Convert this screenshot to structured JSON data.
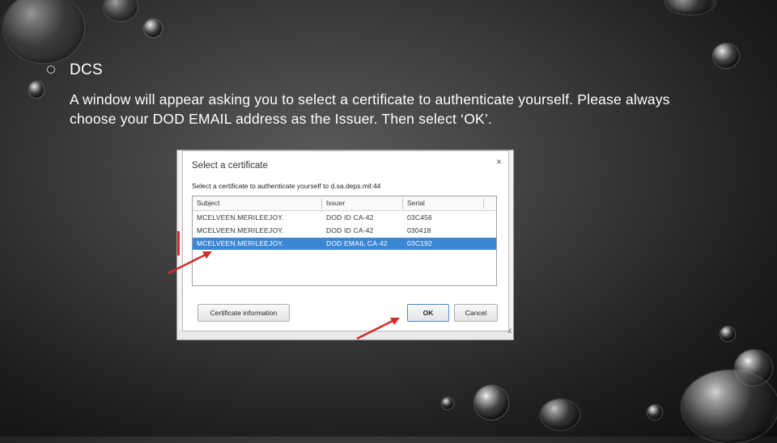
{
  "slide": {
    "heading": "DCS",
    "body": "A window will appear asking you to select a certificate to authenticate yourself. Please always choose your DOD EMAIL address as the Issuer. Then select ‘OK’."
  },
  "dialog": {
    "title": "Select a certificate",
    "prompt": "Select a certificate to authenticate yourself to d.sa.deps.mil:44",
    "columns": [
      "Subject",
      "Issuer",
      "Serial"
    ],
    "rows": [
      {
        "subject": "MCELVEEN.MERILEEJOY.",
        "issuer": "DOD ID CA-42",
        "serial": "03C456"
      },
      {
        "subject": "MCELVEEN.MERILEEJOY.",
        "issuer": "DOD ID CA-42",
        "serial": "030418"
      },
      {
        "subject": "MCELVEEN.MERILEEJOY.",
        "issuer": "DOD EMAIL CA-42",
        "serial": "03C192"
      }
    ],
    "selected_row": 2,
    "cert_info_label": "Certificate information",
    "ok_label": "OK",
    "cancel_label": "Cancel",
    "close_glyph": "×",
    "selection_color": "#3b87d6"
  },
  "underlay": {
    "trailing_char": "k"
  },
  "annotation_color": "#d42a2a"
}
